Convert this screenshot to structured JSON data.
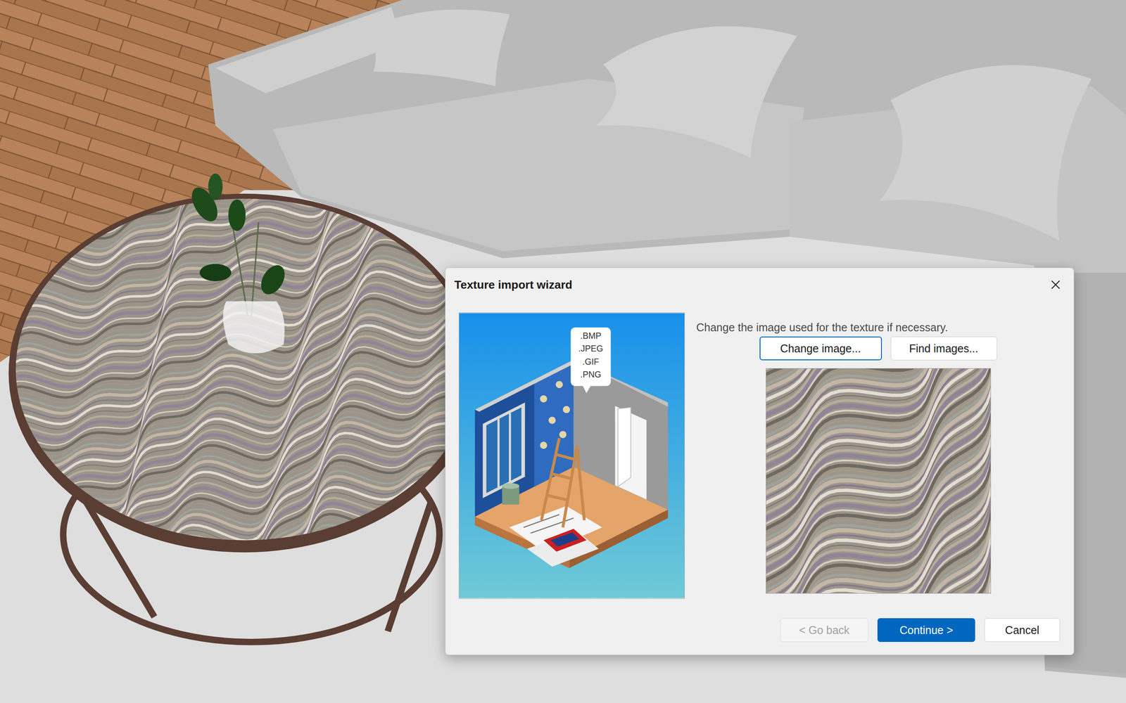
{
  "window": {
    "title": "Texture import wizard"
  },
  "illustration": {
    "formats": [
      ".BMP",
      ".JPEG",
      ".GIF",
      ".PNG"
    ]
  },
  "instruction": "Change the image used for the texture if necessary.",
  "image_buttons": [
    {
      "label": "Change image...",
      "focused": true
    },
    {
      "label": "Find images...",
      "focused": false
    }
  ],
  "footer_buttons": [
    {
      "label": "< Go back",
      "disabled": true,
      "primary": false
    },
    {
      "label": "Continue >",
      "disabled": false,
      "primary": true
    },
    {
      "label": "Cancel",
      "disabled": false,
      "primary": false
    }
  ]
}
